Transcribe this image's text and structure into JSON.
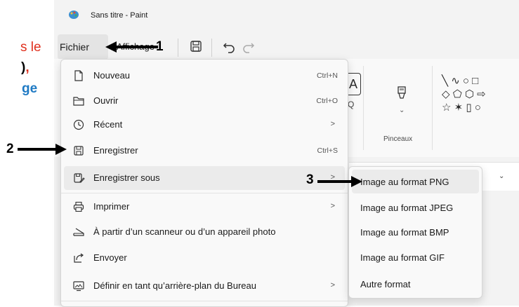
{
  "left_fragments": {
    "line1": "s le",
    "line2_paren": ")",
    "line2_comma": ",",
    "line3": "ge"
  },
  "window": {
    "title": "Sans titre - Paint"
  },
  "menubar": {
    "fichier": "Fichier",
    "affichage": "Affichage"
  },
  "ribbon": {
    "pinceaux": "Pinceaux",
    "shapes_row1": "╲ ∿ ○ □",
    "shapes_row2": "◇ ⬠ ⬡ ⇨",
    "shapes_row3": "☆ ✶ ▯ ○"
  },
  "file_menu": {
    "items": [
      {
        "label": "Nouveau",
        "shortcut": "Ctrl+N",
        "icon": "new-file-icon"
      },
      {
        "label": "Ouvrir",
        "shortcut": "Ctrl+O",
        "icon": "folder-icon"
      },
      {
        "label": "Récent",
        "shortcut": "",
        "icon": "clock-icon"
      },
      {
        "label": "Enregistrer",
        "shortcut": "Ctrl+S",
        "icon": "save-icon"
      },
      {
        "label": "Enregistrer sous",
        "shortcut": "",
        "icon": "save-as-icon"
      },
      {
        "label": "Imprimer",
        "shortcut": "",
        "icon": "printer-icon"
      },
      {
        "label": "À partir d’un scanneur ou d’un appareil photo",
        "shortcut": "",
        "icon": "scanner-icon"
      },
      {
        "label": "Envoyer",
        "shortcut": "",
        "icon": "share-icon"
      },
      {
        "label": "Définir en tant qu’arrière-plan du Bureau",
        "shortcut": "",
        "icon": "desktop-background-icon"
      }
    ],
    "chevron": ">"
  },
  "save_as_submenu": {
    "items": [
      "Image au format PNG",
      "Image au format JPEG",
      "Image au format BMP",
      "Image au format GIF",
      "Autre format"
    ]
  },
  "callouts": {
    "one": "1",
    "two": "2",
    "three": "3"
  },
  "colors": {
    "left_red": "#e0301e",
    "left_blue": "#1f7ac4",
    "menu_bg": "#f9f9f9",
    "hover_bg": "#ebebeb"
  }
}
